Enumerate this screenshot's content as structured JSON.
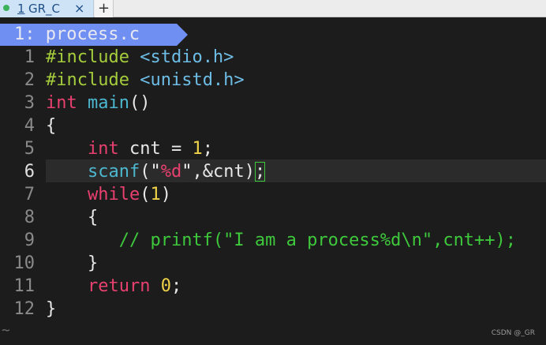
{
  "tab": {
    "number": "1",
    "name": "GR_C",
    "close": "×"
  },
  "new_tab": "+",
  "buffer": {
    "label": "1: process.c"
  },
  "lines": [
    {
      "num": "1",
      "segments": [
        [
          "pp",
          "#include "
        ],
        [
          "hdr",
          "<stdio.h>"
        ]
      ]
    },
    {
      "num": "2",
      "segments": [
        [
          "pp",
          "#include "
        ],
        [
          "hdr",
          "<unistd.h>"
        ]
      ]
    },
    {
      "num": "3",
      "segments": [
        [
          "kw",
          "int"
        ],
        [
          "pl",
          " "
        ],
        [
          "fn",
          "main"
        ],
        [
          "pl",
          "()"
        ]
      ]
    },
    {
      "num": "4",
      "segments": [
        [
          "pl",
          "{"
        ]
      ]
    },
    {
      "num": "5",
      "segments": [
        [
          "pl",
          "    "
        ],
        [
          "kw",
          "int"
        ],
        [
          "pl",
          " cnt = "
        ],
        [
          "num",
          "1"
        ],
        [
          "pl",
          ";"
        ]
      ]
    },
    {
      "num": "6",
      "current": true,
      "segments": [
        [
          "pl",
          "    "
        ],
        [
          "fn",
          "scanf"
        ],
        [
          "pl",
          "("
        ],
        [
          "str",
          "\""
        ],
        [
          "fmt",
          "%d"
        ],
        [
          "str",
          "\""
        ],
        [
          "pl",
          ",&cnt)"
        ],
        [
          "cur",
          ";"
        ]
      ]
    },
    {
      "num": "7",
      "segments": [
        [
          "pl",
          "    "
        ],
        [
          "kw",
          "while"
        ],
        [
          "pl",
          "("
        ],
        [
          "num",
          "1"
        ],
        [
          "pl",
          ")"
        ]
      ]
    },
    {
      "num": "8",
      "segments": [
        [
          "pl",
          "    {"
        ]
      ]
    },
    {
      "num": "9",
      "segments": [
        [
          "pl",
          "       "
        ],
        [
          "cmt",
          "// printf(\"I am a process%d\\n\",cnt++);"
        ]
      ]
    },
    {
      "num": "10",
      "segments": [
        [
          "pl",
          "    }"
        ]
      ]
    },
    {
      "num": "11",
      "segments": [
        [
          "pl",
          "    "
        ],
        [
          "kw",
          "return"
        ],
        [
          "pl",
          " "
        ],
        [
          "num",
          "0"
        ],
        [
          "pl",
          ";"
        ]
      ]
    },
    {
      "num": "12",
      "segments": [
        [
          "pl",
          "}"
        ]
      ]
    }
  ],
  "tilde": "~",
  "watermark": "CSDN @_GR",
  "colors": {
    "accent": "#6f8ff3",
    "preprocessor": "#a5cc3c",
    "keyword": "#e8406f",
    "function": "#4cb8d0",
    "number": "#f0d24a",
    "comment": "#3ec83c"
  }
}
